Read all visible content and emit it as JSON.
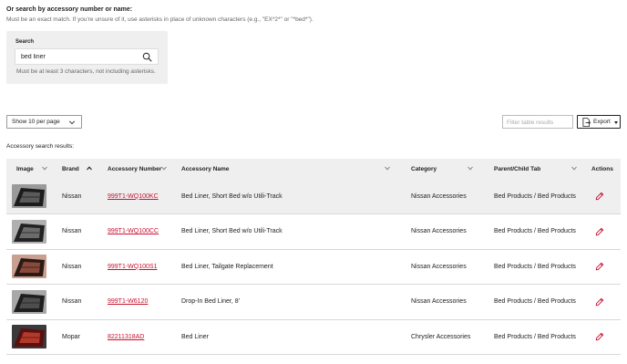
{
  "search": {
    "heading": "Or search by accessory number or name:",
    "subtext": "Must be an exact match. If you're unsure of it, use asterisks in place of unknown characters (e.g., \"EX*2*\" or \"*bed*\").",
    "label": "Search",
    "value": "bed liner",
    "hint": "Must be at least 3 characters, not including asterisks.",
    "icon": "search-icon"
  },
  "controls": {
    "per_page": "Show 10 per page",
    "filter_placeholder": "Filter table results",
    "export_label": "Export"
  },
  "results_label": "Accessory search results:",
  "table": {
    "headers": [
      "Image",
      "Brand",
      "Accessory Number",
      "Accessory Name",
      "Category",
      "Parent/Child Tab",
      "Actions"
    ],
    "sorted_column": "Brand",
    "rows": [
      {
        "brand": "Nissan",
        "number": "999T1-WQ100KC",
        "name": "Bed Liner, Short Bed w/o Utili-Track",
        "category": "Nissan Accessories",
        "tab": "Bed Products / Bed Products",
        "selected": true
      },
      {
        "brand": "Nissan",
        "number": "999T1-WQ100CC",
        "name": "Bed Liner, Short Bed w/o Utili-Track",
        "category": "Nissan Accessories",
        "tab": "Bed Products / Bed Products",
        "selected": false
      },
      {
        "brand": "Nissan",
        "number": "999T1-WQ100S1",
        "name": "Bed Liner, Tailgate Replacement",
        "category": "Nissan Accessories",
        "tab": "Bed Products / Bed Products",
        "selected": false
      },
      {
        "brand": "Nissan",
        "number": "999T1-W6120",
        "name": "Drop-In Bed Liner, 8'",
        "category": "Nissan Accessories",
        "tab": "Bed Products / Bed Products",
        "selected": false
      },
      {
        "brand": "Mopar",
        "number": "82211318AD",
        "name": "Bed Liner",
        "category": "Chrysler Accessories",
        "tab": "Bed Products / Bed Products",
        "selected": false
      }
    ]
  },
  "colors": {
    "link": "#c8102e",
    "header_bg": "#efefef",
    "edit_icon": "#c8102e"
  }
}
